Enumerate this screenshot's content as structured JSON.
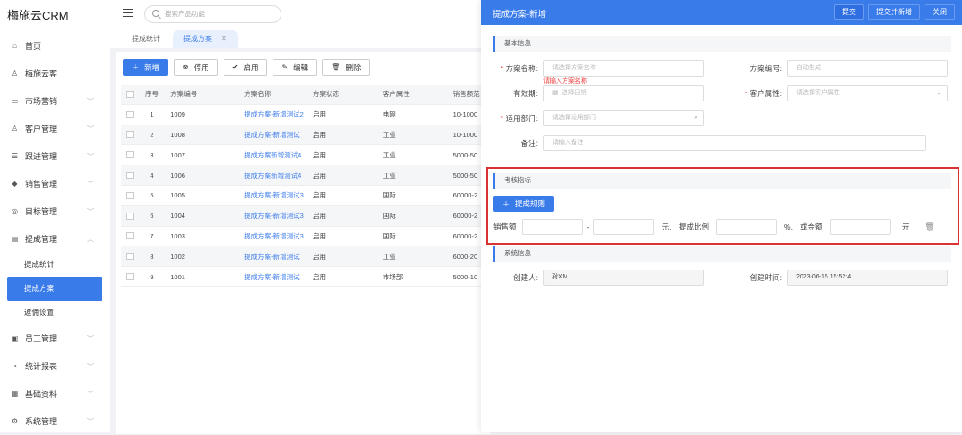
{
  "app": {
    "title": "梅施云CRM"
  },
  "sidebar": {
    "items": [
      {
        "label": "首页",
        "icon": "home-icon"
      },
      {
        "label": "梅施云客",
        "icon": "user-icon"
      },
      {
        "label": "市场营销",
        "icon": "market-icon"
      },
      {
        "label": "客户管理",
        "icon": "customer-icon"
      },
      {
        "label": "跟进管理",
        "icon": "follow-icon"
      },
      {
        "label": "销售管理",
        "icon": "sales-icon"
      },
      {
        "label": "目标管理",
        "icon": "target-icon"
      },
      {
        "label": "提成管理",
        "icon": "commission-icon"
      }
    ],
    "sub_items": [
      "提成统计",
      "提成方案",
      "返佣设置"
    ],
    "more_items": [
      {
        "label": "员工管理",
        "icon": "staff-icon"
      },
      {
        "label": "统计报表",
        "icon": "report-icon"
      },
      {
        "label": "基础资料",
        "icon": "data-icon"
      },
      {
        "label": "系统管理",
        "icon": "settings-icon"
      }
    ]
  },
  "topbar": {
    "search_placeholder": "搜索产品功能"
  },
  "tabs": [
    {
      "label": "提成统计"
    },
    {
      "label": "提成方案"
    }
  ],
  "toolbar": {
    "add": "新增",
    "disable": "停用",
    "enable": "启用",
    "edit": "编辑",
    "delete": "删除"
  },
  "table": {
    "headers": [
      "序号",
      "方案编号",
      "方案名称",
      "方案状态",
      "客户属性",
      "销售额范"
    ],
    "rows": [
      [
        "1",
        "1009",
        "提成方案-新增测试2",
        "启用",
        "电网",
        "10-1000"
      ],
      [
        "2",
        "1008",
        "提成方案-新增测试",
        "启用",
        "工业",
        "10-1000"
      ],
      [
        "3",
        "1007",
        "提成方案新增测试4",
        "启用",
        "工业",
        "5000-50"
      ],
      [
        "4",
        "1006",
        "提成方案新增测试4",
        "启用",
        "工业",
        "5000-50"
      ],
      [
        "5",
        "1005",
        "提成方案-新增测试3",
        "启用",
        "国际",
        "60000-2"
      ],
      [
        "6",
        "1004",
        "提成方案-新增测试3",
        "启用",
        "国际",
        "60000-2"
      ],
      [
        "7",
        "1003",
        "提成方案-新增测试3",
        "启用",
        "国际",
        "60000-2"
      ],
      [
        "8",
        "1002",
        "提成方案-新增测试",
        "启用",
        "工业",
        "6000-20"
      ],
      [
        "9",
        "1001",
        "提成方案-新增测试",
        "启用",
        "市场部",
        "5000-10"
      ]
    ]
  },
  "drawer": {
    "title": "提成方案-新增",
    "submit": "提交",
    "submit_new": "提交并新增",
    "close": "关闭",
    "basic_section": "基本信息",
    "name_label": "方案名称:",
    "name_placeholder": "请选择方案名称",
    "name_error": "请输入方案名称",
    "code_label": "方案编号:",
    "code_placeholder": "自动生成",
    "valid_label": "有效期:",
    "valid_placeholder": "选择日期",
    "attr_label": "客户属性:",
    "attr_placeholder": "请选择客户属性",
    "dept_label": "适用部门:",
    "dept_placeholder": "请选择适用部门",
    "remark_label": "备注:",
    "remark_placeholder": "请输入备注",
    "kpi_section": "考核指标",
    "add_rule": "提成规则",
    "sales_label": "销售额",
    "dash": "-",
    "yuan_comma": "元,",
    "ratio_label": "提成比例",
    "pct_comma": "%,",
    "fixed_label": "或金额",
    "yuan": "元",
    "sys_section": "系统信息",
    "creator_label": "创建人:",
    "creator_value": "孙XM",
    "created_label": "创建时间:",
    "created_value": "2023-06-15  15:52:4"
  },
  "colors": {
    "primary": "#3a7bea",
    "highlight_box": "#d93232"
  }
}
